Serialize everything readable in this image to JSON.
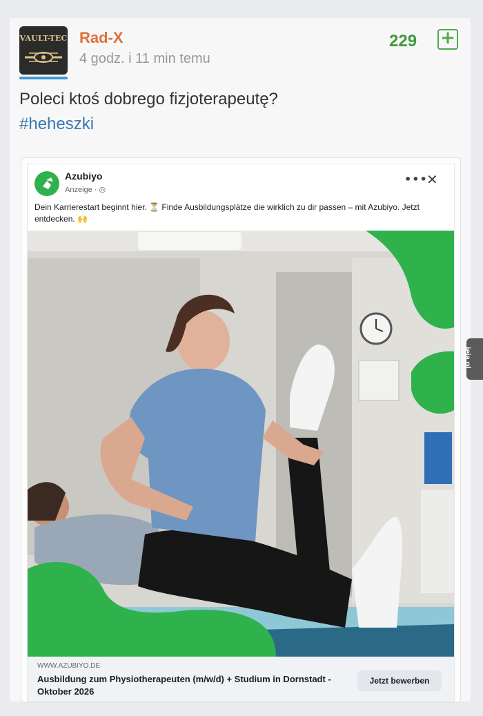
{
  "post": {
    "username": "Rad-X",
    "time": "4 godz. i 11 min temu",
    "score": "229",
    "vote_label": "+",
    "text": "Poleci ktoś dobrego fizjoterapeutę?",
    "hashtag": "#heheszki",
    "avatar_text": "VAULT-TEC"
  },
  "ad": {
    "brand": "Azubiyo",
    "sponsored": "Anzeige · ",
    "more_icon": "more-dots-icon",
    "close_icon": "close-icon",
    "body_part1": "Dein Karrierestart beginnt hier. ",
    "body_part2": " Finde Ausbildungsplätze die wirklich zu dir passen – mit Azubiyo. Jetzt entdecken.",
    "url": "WWW.AZUBIYO.DE",
    "headline": "Ausbildung zum Physiotherapeuten (m/w/d) + Studium in Dornstadt - Oktober 2026",
    "cta": "Jetzt bewerben",
    "accent_color": "#2fb14c"
  },
  "watermark": "jeja.pl"
}
